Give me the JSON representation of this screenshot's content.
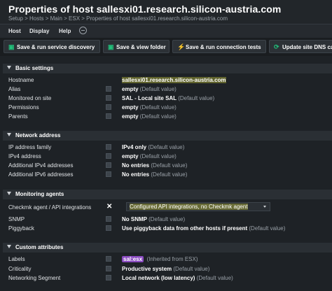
{
  "header": {
    "title": "Properties of host sallesxi01.research.silicon-austria.com",
    "breadcrumb": "Setup > Hosts > Main > ESX > Properties of host sallesxi01.research.silicon-austria.com"
  },
  "menu": {
    "host": "Host",
    "display": "Display",
    "help": "Help",
    "help_toggle_icon": "minus-circle-icon"
  },
  "toolbar": {
    "save_discovery": "Save & run service discovery",
    "save_view": "Save & view folder",
    "save_tests": "Save & run connection tests",
    "update_dns": "Update site DNS ca"
  },
  "sections": {
    "basic": {
      "title": "Basic settings",
      "hostname_label": "Hostname",
      "hostname_value": "sallesxi01.research.silicon-austria.com",
      "alias_label": "Alias",
      "alias_value": "empty",
      "alias_default": "(Default value)",
      "monitored_label": "Monitored on site",
      "monitored_value": "SAL - Local site SAL",
      "monitored_default": "(Default value)",
      "permissions_label": "Permissions",
      "permissions_value": "empty",
      "permissions_default": "(Default value)",
      "parents_label": "Parents",
      "parents_value": "empty",
      "parents_default": "(Default value)"
    },
    "network": {
      "title": "Network address",
      "ipfamily_label": "IP address family",
      "ipfamily_value": "IPv4 only",
      "ipfamily_default": "(Default value)",
      "ipv4_label": "IPv4 address",
      "ipv4_value": "empty",
      "ipv4_default": "(Default value)",
      "addipv4_label": "Additional IPv4 addresses",
      "addipv4_value": "No entries",
      "addipv4_default": "(Default value)",
      "addipv6_label": "Additional IPv6 addresses",
      "addipv6_value": "No entries",
      "addipv6_default": "(Default value)"
    },
    "monitoring": {
      "title": "Monitoring agents",
      "agent_label": "Checkmk agent / API integrations",
      "agent_value": "Configured API integrations, no Checkmk agent",
      "snmp_label": "SNMP",
      "snmp_value": "No SNMP",
      "snmp_default": "(Default value)",
      "piggy_label": "Piggyback",
      "piggy_value": "Use piggyback data from other hosts if present",
      "piggy_default": "(Default value)"
    },
    "custom": {
      "title": "Custom attributes",
      "labels_label": "Labels",
      "labels_chip": "sal:esx",
      "labels_note": "(Inherited from ESX)",
      "crit_label": "Criticality",
      "crit_value": "Productive system",
      "crit_default": "(Default value)",
      "netseg_label": "Networking Segment",
      "netseg_value": "Local network (low latency)",
      "netseg_default": "(Default value)"
    }
  },
  "colors": {
    "accent_green": "#21c07a",
    "highlight_yellow": "#f5f58a",
    "label_purple": "#8a4bc0"
  }
}
